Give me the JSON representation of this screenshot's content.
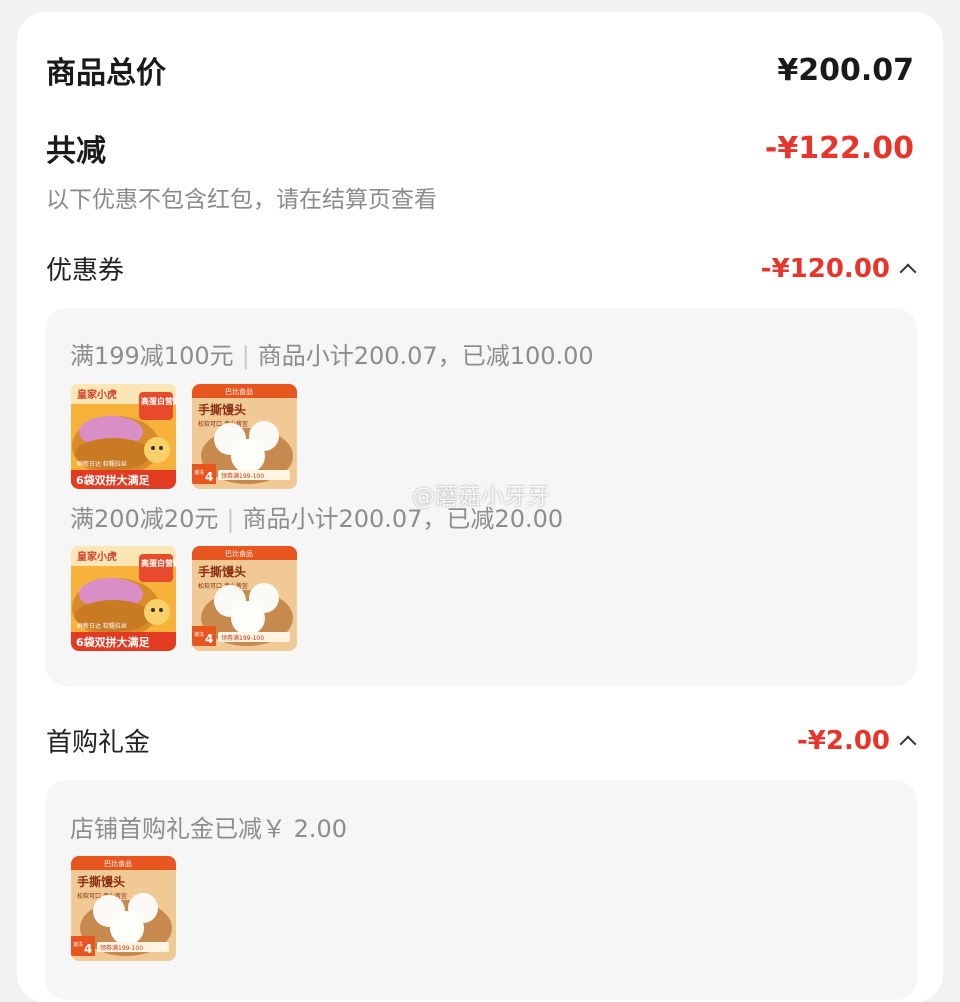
{
  "summary": {
    "total_label": "商品总价",
    "total_value": "¥200.07",
    "discount_label": "共减",
    "discount_value": "-¥122.00",
    "note": "以下优惠不包含红包，请在结算页查看"
  },
  "coupon": {
    "label": "优惠券",
    "value": "-¥120.00",
    "rules": [
      {
        "condition": "满199减100元",
        "detail": "商品小计200.07，已减100.00",
        "separator": "|"
      },
      {
        "condition": "满200减20元",
        "detail": "商品小计200.07，已减20.00",
        "separator": "|"
      }
    ]
  },
  "first_gift": {
    "label": "首购礼金",
    "value": "-¥2.00",
    "detail": "店铺首购礼金已减￥ 2.00"
  },
  "products": {
    "bread": {
      "brand": "皇家小虎",
      "tag": "高蛋白营养多",
      "banner": "6袋双拼大满足",
      "chips": "鲜新日达 软糯拉丝"
    },
    "bun": {
      "shop": "巴比食品",
      "title": "手撕馒头",
      "desc": "松软可口 老少皆宜",
      "num": "4",
      "prefix": "速冻",
      "promo": "领券满199-100"
    }
  },
  "watermark": "@蘑菇小牙牙",
  "colors": {
    "accent": "#e8352b",
    "panel": "#f6f6f6"
  }
}
